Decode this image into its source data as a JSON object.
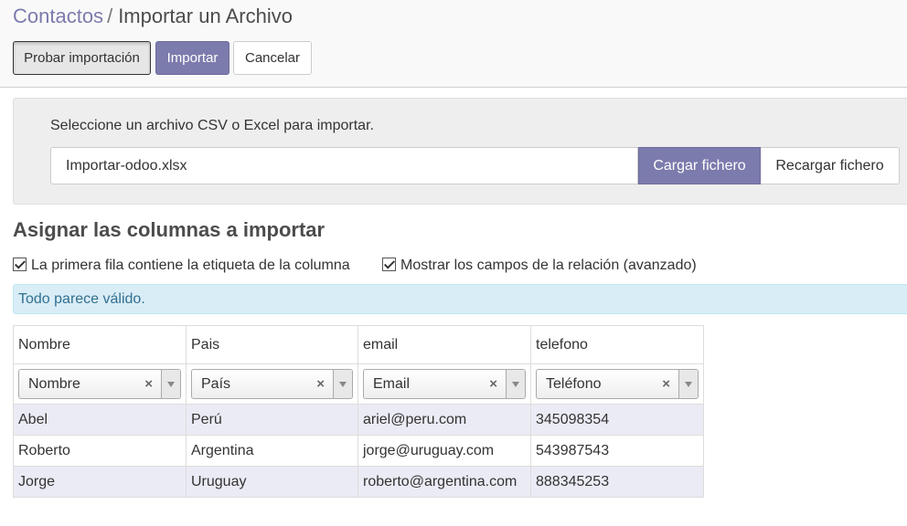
{
  "breadcrumb": {
    "parent": "Contactos",
    "separator": "/",
    "current": "Importar un Archivo"
  },
  "toolbar": {
    "test_label": "Probar importación",
    "import_label": "Importar",
    "cancel_label": "Cancelar"
  },
  "file": {
    "hint": "Seleccione un archivo CSV o Excel para importar.",
    "filename": "Importar-odoo.xlsx",
    "upload_label": "Cargar fichero",
    "reload_label": "Recargar fichero"
  },
  "mapping": {
    "title": "Asignar las columnas a importar",
    "options": [
      {
        "label": "La primera fila contiene la etiqueta de la columna",
        "checked": true
      },
      {
        "label": "Mostrar los campos de la relación (avanzado)",
        "checked": true
      }
    ],
    "status": "Todo parece válido."
  },
  "table": {
    "headers": [
      "Nombre",
      "Pais",
      "email",
      "telefono"
    ],
    "mappings": [
      "Nombre",
      "País",
      "Email",
      "Teléfono"
    ],
    "clear_symbol": "×",
    "rows": [
      [
        "Abel",
        "Perú",
        "ariel@peru.com",
        "345098354"
      ],
      [
        "Roberto",
        "Argentina",
        "jorge@uruguay.com",
        "543987543"
      ],
      [
        "Jorge",
        "Uruguay",
        "roberto@argentina.com",
        "888345253"
      ]
    ]
  },
  "colors": {
    "primary": "#7c7bad",
    "alert_bg": "#d9edf7",
    "alert_text": "#31708f",
    "row_stripe": "#ebebf5"
  }
}
